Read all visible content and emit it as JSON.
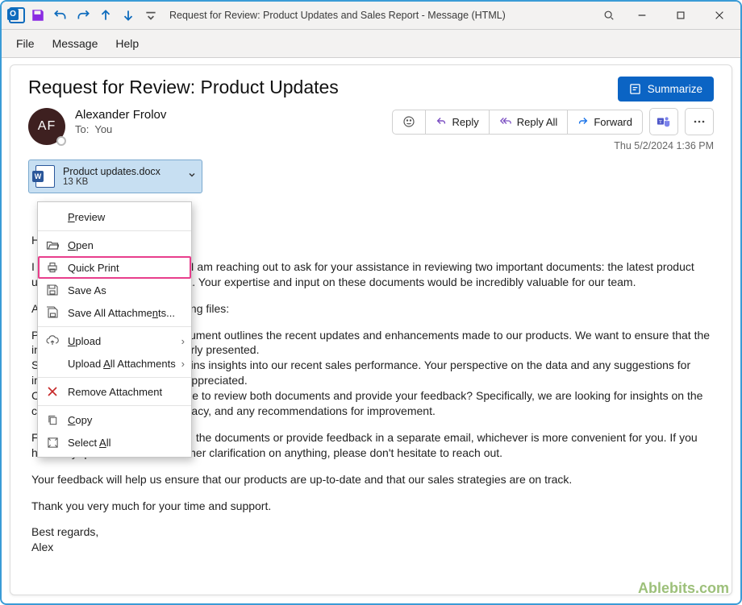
{
  "titlebar": {
    "title": "Request for Review: Product Updates and Sales Report  -  Message (HTML)"
  },
  "menubar": {
    "file": "File",
    "message": "Message",
    "help": "Help"
  },
  "header": {
    "subject": "Request for Review: Product Updates",
    "summarize_label": "Summarize",
    "avatar_initials": "AF",
    "from_name": "Alexander Frolov",
    "to_label": "To:",
    "to_value": "You",
    "reply": "Reply",
    "reply_all": "Reply All",
    "forward": "Forward",
    "timestamp": "Thu 5/2/2024 1:36 PM"
  },
  "attachment": {
    "name": "Product updates.docx",
    "size": "13 KB"
  },
  "context_menu": {
    "preview": "Preview",
    "open": "Open",
    "quick_print": "Quick Print",
    "save_as": "Save As",
    "save_all": "Save All Attachments...",
    "upload": "Upload",
    "upload_all": "Upload All Attachments",
    "remove": "Remove Attachment",
    "copy": "Copy",
    "select_all": "Select All"
  },
  "body": {
    "p1": "Hi Team,",
    "p2": "I hope this email finds you well. I am reaching out to ask for your assistance in reviewing two important documents: the latest product updates file and the sales report. Your expertise and input on these documents would be incredibly valuable for our team.",
    "p3": "Attached, please find the following files:",
    "p4": "Product updates.docx - this document outlines the recent updates and enhancements made to our products. We want to ensure that the information is accurate and clearly presented.",
    "p5": "Sales report.xlsx - this file contains insights into our recent sales performance. Your perspective on the data and any suggestions for improvement would be greatly appreciated.",
    "p6": "Could you please take some time to review both documents and provide your feedback? Specifically, we are looking for insights on the clarity of information, data accuracy, and any recommendations for improvement.",
    "p7": "Feel free to comment directly on the documents or provide feedback in a separate email, whichever is more convenient for you. If you have any questions or need further clarification on anything, please don't hesitate to reach out.",
    "p8": "Your feedback will help us ensure that our products are up-to-date and that our sales strategies are on track.",
    "p9": "Thank you very much for your time and support.",
    "p10": "Best regards,",
    "p11": "Alex"
  },
  "watermark": "Ablebits.com"
}
